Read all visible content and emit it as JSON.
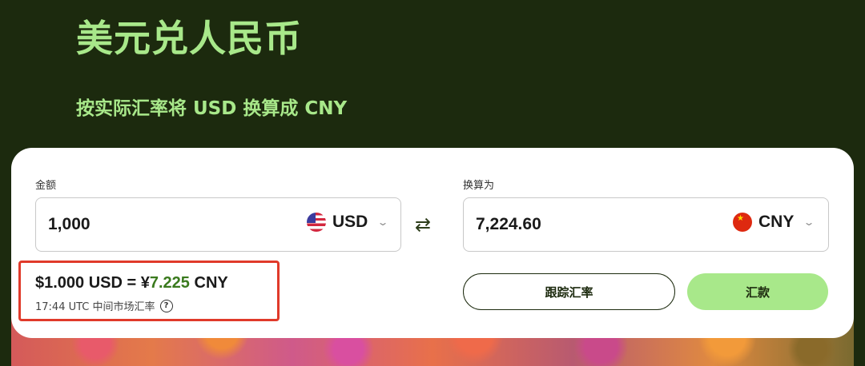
{
  "page": {
    "title": "美元兑人民币",
    "subtitle": "按实际汇率将 USD 换算成 CNY"
  },
  "converter": {
    "amount_label": "金额",
    "amount_value": "1,000",
    "from_currency": "USD",
    "convert_to_label": "换算为",
    "converted_value": "7,224.60",
    "to_currency": "CNY"
  },
  "rate": {
    "prefix": "$1.000 USD = ¥",
    "value": "7.225",
    "suffix": " CNY",
    "timestamp_text": "17:44 UTC 中间市场汇率"
  },
  "actions": {
    "track_label": "跟踪汇率",
    "send_label": "汇款"
  },
  "colors": {
    "background": "#1c2a0e",
    "accent_green": "#a8e88a",
    "rate_green": "#3a7a1e",
    "highlight_red": "#e03a2a"
  },
  "icons": {
    "swap": "swap-arrows-icon",
    "help": "question-circle-icon",
    "dropdown": "chevron-down-icon"
  }
}
